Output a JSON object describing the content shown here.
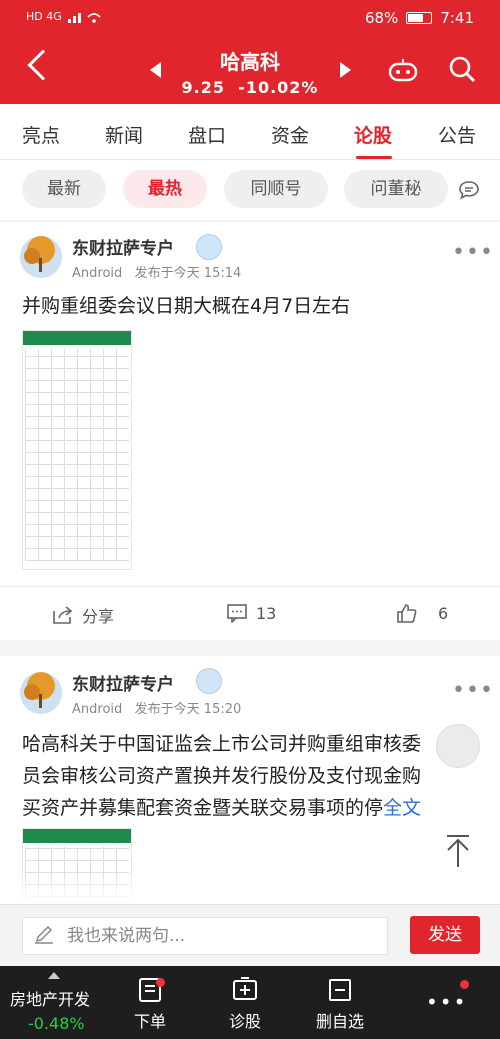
{
  "status": {
    "left_text": "HD 4G",
    "battery": "68%",
    "time": "7:41",
    "battery_level": 0.68
  },
  "header": {
    "title": "哈高科",
    "price": "9.25",
    "change": "-10.02%"
  },
  "tabs": [
    {
      "label": "亮点"
    },
    {
      "label": "新闻"
    },
    {
      "label": "盘口"
    },
    {
      "label": "资金"
    },
    {
      "label": "论股"
    },
    {
      "label": "公告"
    }
  ],
  "chips": [
    {
      "label": "最新"
    },
    {
      "label": "最热"
    },
    {
      "label": "同顺号"
    },
    {
      "label": "问董秘"
    }
  ],
  "posts": [
    {
      "author": "东财拉萨专户",
      "device": "Android",
      "time": "发布于今天 15:14",
      "text": "并购重组委会议日期大概在4月7日左右",
      "share": "分享",
      "comments": "13",
      "likes": "6"
    },
    {
      "author": "东财拉萨专户",
      "device": "Android",
      "time": "发布于今天 15:20",
      "line1": "哈高科关于中国证监会上市公司并购重组审核委",
      "line2": "员会审核公司资产置换并发行股份及支付现金购",
      "line3": "买资产并募集配套资金暨关联交易事项的停",
      "more": "全文"
    }
  ],
  "input": {
    "placeholder": "我也来说两句...",
    "send": "发送"
  },
  "nav": {
    "sector": "房地产开发",
    "sector_change": "-0.48%",
    "items": [
      {
        "label": "下单"
      },
      {
        "label": "诊股"
      },
      {
        "label": "删自选"
      }
    ]
  },
  "colors": {
    "brand_red": "#e0262c",
    "nav_bg": "#1e1e1e",
    "down_green": "#2ecc40"
  },
  "icons": [
    "back-arrow-icon",
    "prev-stock-icon",
    "next-stock-icon",
    "robot-icon",
    "search-icon",
    "chat-icon",
    "more-dots-icon",
    "share-icon",
    "comment-icon",
    "like-icon",
    "pencil-icon",
    "back-to-top-icon",
    "order-icon",
    "diagnose-icon",
    "remove-favorite-icon"
  ]
}
